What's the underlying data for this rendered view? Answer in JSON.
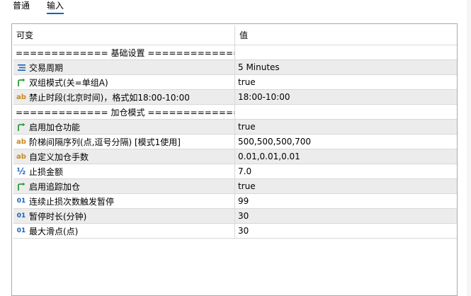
{
  "tabs": [
    {
      "label": "普通",
      "active": false
    },
    {
      "label": "输入",
      "active": true
    }
  ],
  "grid": {
    "headers": {
      "name": "可变",
      "value": "值"
    },
    "rows": [
      {
        "kind": "section",
        "icon": "",
        "name": "============= 基础设置 ===============",
        "value": ""
      },
      {
        "kind": "param",
        "icon": "enum-icon",
        "name": "交易周期",
        "value": "5 Minutes"
      },
      {
        "kind": "param",
        "icon": "bool-icon",
        "name": "双组模式(关=单组A)",
        "value": "true"
      },
      {
        "kind": "param",
        "icon": "string-icon",
        "name": "禁止时段(北京时间)，格式如18:00-10:00",
        "value": "18:00-10:00"
      },
      {
        "kind": "section",
        "icon": "",
        "name": "============= 加仓模式 =============",
        "value": ""
      },
      {
        "kind": "param",
        "icon": "bool-icon",
        "name": "启用加仓功能",
        "value": "true"
      },
      {
        "kind": "param",
        "icon": "string-icon",
        "name": "阶梯间隔序列(点,逗号分隔) [模式1使用]",
        "value": "500,500,500,700"
      },
      {
        "kind": "param",
        "icon": "string-icon",
        "name": "自定义加仓手数",
        "value": "0.01,0.01,0.01"
      },
      {
        "kind": "param",
        "icon": "double-icon",
        "name": "止损金额",
        "value": "7.0"
      },
      {
        "kind": "param",
        "icon": "bool-icon",
        "name": "启用追踪加仓",
        "value": "true"
      },
      {
        "kind": "param",
        "icon": "int-icon",
        "name": "连续止损次数触发暂停",
        "value": "99"
      },
      {
        "kind": "param",
        "icon": "int-icon",
        "name": "暂停时长(分钟)",
        "value": "30"
      },
      {
        "kind": "param",
        "icon": "int-icon",
        "name": "最大滑点(点)",
        "value": "30"
      }
    ]
  },
  "icon_glyphs": {
    "string-icon": "ab",
    "int-icon": "01",
    "double-icon": "½"
  },
  "colors": {
    "tab_underline": "#0a64c8",
    "row_alt": "#ececec",
    "bool_icon": "#2e9b3a",
    "string_icon": "#c98a1b",
    "int_icon": "#1a5fb4"
  }
}
